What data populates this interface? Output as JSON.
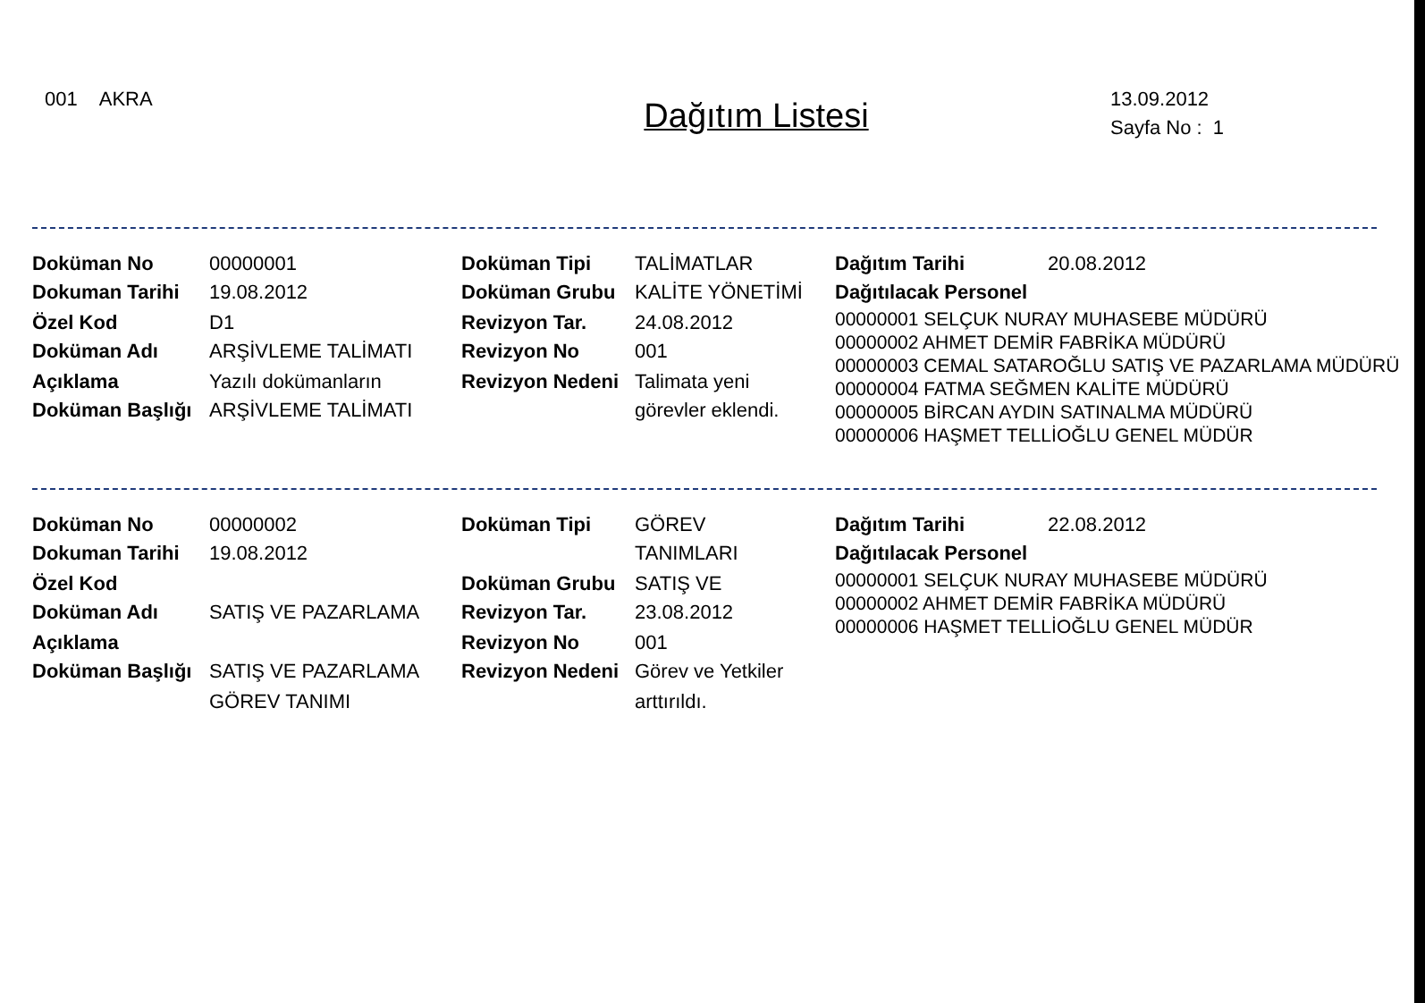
{
  "header": {
    "company_code": "001",
    "company_name": "AKRA",
    "title": "Dağıtım Listesi",
    "date": "13.09.2012",
    "page_label": "Sayfa No :",
    "page_number": "1"
  },
  "records": [
    {
      "left": [
        {
          "label": "Doküman No",
          "value": "00000001"
        },
        {
          "label": "Dokuman Tarihi",
          "value": "19.08.2012"
        },
        {
          "label": "Özel Kod",
          "value": "D1"
        },
        {
          "label": "Doküman Adı",
          "value": "ARŞİVLEME TALİMATI"
        },
        {
          "label": "Açıklama",
          "value": "Yazılı dokümanların"
        },
        {
          "label": "Doküman Başlığı",
          "value": "ARŞİVLEME TALİMATI"
        }
      ],
      "middle": [
        {
          "label": "Doküman Tipi",
          "value": "TALİMATLAR"
        },
        {
          "label": "Doküman Grubu",
          "value": "KALİTE YÖNETİMİ"
        },
        {
          "label": "Revizyon Tar.",
          "value": "24.08.2012"
        },
        {
          "label": "Revizyon No",
          "value": "001"
        },
        {
          "label": "Revizyon Nedeni",
          "value": "Talimata yeni görevler eklendi."
        }
      ],
      "distribution_date": {
        "label": "Dağıtım Tarihi",
        "value": "20.08.2012"
      },
      "personnel_label": "Dağıtılacak Personel",
      "personnel": [
        "00000001 SELÇUK NURAY MUHASEBE MÜDÜRÜ",
        "00000002 AHMET DEMİR FABRİKA MÜDÜRÜ",
        "00000003 CEMAL SATAROĞLU SATIŞ VE PAZARLAMA MÜDÜRÜ",
        "00000004 FATMA SEĞMEN KALİTE MÜDÜRÜ",
        "00000005 BİRCAN AYDIN SATINALMA MÜDÜRÜ",
        "00000006 HAŞMET TELLİOĞLU GENEL MÜDÜR"
      ]
    },
    {
      "left": [
        {
          "label": "Doküman No",
          "value": "00000002"
        },
        {
          "label": "Dokuman Tarihi",
          "value": "19.08.2012"
        },
        {
          "label": "Özel Kod"
        },
        {
          "label": "Doküman Adı",
          "value": "SATIŞ VE PAZARLAMA"
        },
        {
          "label": "Açıklama"
        },
        {
          "label": "Doküman Başlığı",
          "value": "SATIŞ VE PAZARLAMA GÖREV TANIMI"
        }
      ],
      "middle": [
        {
          "label": "Doküman Tipi",
          "value": "GÖREV TANIMLARI"
        },
        {
          "label": "Doküman Grubu",
          "value": "SATIŞ VE"
        },
        {
          "label": "Revizyon Tar.",
          "value": "23.08.2012"
        },
        {
          "label": "Revizyon No",
          "value": "001"
        },
        {
          "label": "Revizyon Nedeni",
          "value": "Görev ve Yetkiler arttırıldı."
        }
      ],
      "distribution_date": {
        "label": "Dağıtım Tarihi",
        "value": "22.08.2012"
      },
      "personnel_label": "Dağıtılacak Personel",
      "personnel": [
        "00000001 SELÇUK NURAY MUHASEBE MÜDÜRÜ",
        "00000002 AHMET DEMİR FABRİKA MÜDÜRÜ",
        "00000006 HAŞMET TELLİOĞLU GENEL MÜDÜR"
      ]
    }
  ]
}
